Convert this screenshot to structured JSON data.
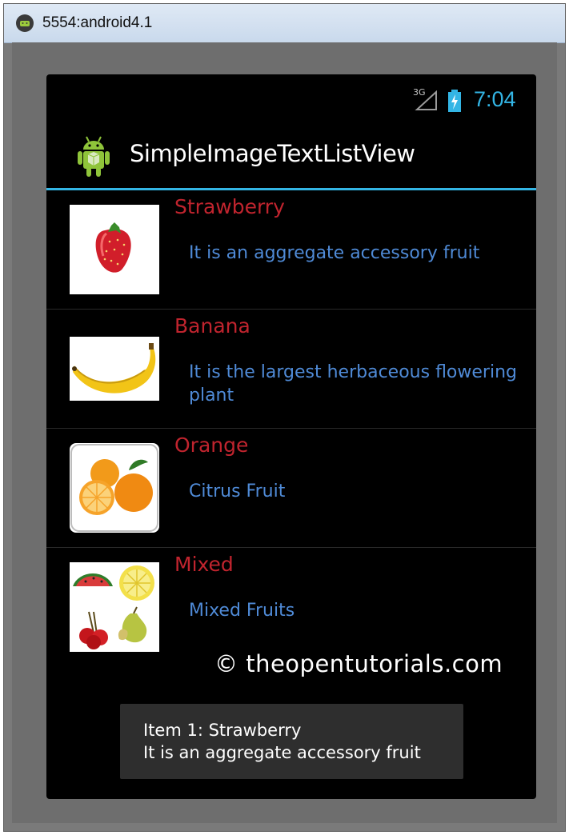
{
  "window": {
    "title": "5554:android4.1",
    "icon": "android-emulator-icon"
  },
  "status_bar": {
    "network": "3G",
    "time": "7:04",
    "icons": [
      "signal-icon",
      "battery-charging-icon"
    ],
    "accent_color": "#33b5e5"
  },
  "action_bar": {
    "title": "SimpleImageTextListView",
    "icon": "android-app-icon"
  },
  "list": {
    "items": [
      {
        "title": "Strawberry",
        "description": "It is an aggregate accessory fruit",
        "image": "strawberry-image"
      },
      {
        "title": "Banana",
        "description": "It is the largest herbaceous flowering plant",
        "image": "banana-image"
      },
      {
        "title": "Orange",
        "description": "Citrus Fruit",
        "image": "orange-image"
      },
      {
        "title": "Mixed",
        "description": "Mixed Fruits",
        "image": "mixed-fruits-image"
      }
    ],
    "title_color": "#c0242e",
    "description_color": "#4f8ad6"
  },
  "watermark": "© theopentutorials.com",
  "toast": {
    "line1": "Item 1: Strawberry",
    "line2": "It is an aggregate accessory fruit"
  }
}
